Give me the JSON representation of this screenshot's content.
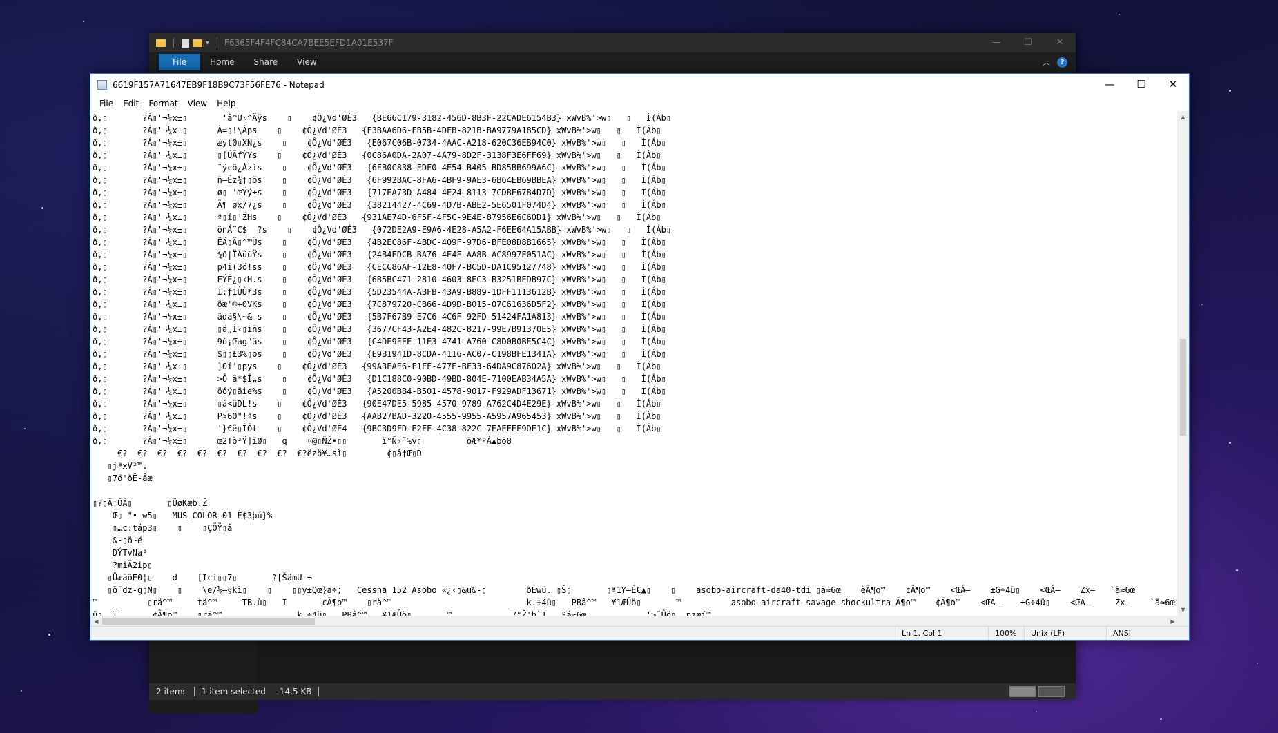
{
  "explorer": {
    "title": "F6365F4F4FC84CA7BEE5EFD1A01E537F",
    "ribbon_tabs": [
      "File",
      "Home",
      "Share",
      "View"
    ],
    "status": {
      "items": "2 items",
      "selected": "1 item selected",
      "size": "14.5 KB"
    }
  },
  "notepad": {
    "title": "6619F157A71647EB9F18B9C73F56FE76 - Notepad",
    "menu": [
      "File",
      "Edit",
      "Format",
      "View",
      "Help"
    ],
    "content_lines": [
      "ð,▯       ?Á▯'¬¼x±▯       'â^U‹^Äÿs    ▯    ¢Ô¿Vd'ØÉ3   {BE66C179-3182-456D-8B3F-22CADE6154B3} xWvB%'>w▯   ▯   Ì(Áb▯",
      "ð,▯       ?Á▯'¬¼x±▯      À=▯!\\Âps    ▯    ¢Ô¿Vd'ØÉ3   {F3BAA6D6-FB5B-4DFB-821B-BA9779A185CD} xWvB%'>w▯   ▯   Ì(Áb▯",
      "ð,▯       ?Á▯'¬¼x±▯      æyt0▯XN¿s    ▯    ¢Ô¿Vd'ØÉ3   {E067C06B-0734-4AAC-A218-620C36EB94C0} xWvB%'>w▯   ▯   Ì(Áb▯",
      "ð,▯       ?Á▯'¬¼x±▯      ▯[ÜÃfÝYs    ▯    ¢Ô¿Vd'ØÉ3   {0C86A0DA-2A07-4A79-8D2F-3138F3E6FF69} xWvB%'>w▯   ▯   Ì(Áb▯",
      "ð,▯       ?Á▯'¬¼x±▯      ¨ÿcö¿Àzìs    ▯    ¢Ô¿Vd'ØÉ3   {6FB0C838-EDF0-4E54-B405-BD85BB699A6C} xWvB%'>w▯   ▯   Ì(Áb▯",
      "ð,▯       ?Á▯'¬¼x±▯      ñ–Ëz¾†▯ös    ▯    ¢Ô¿Vd'ØÉ3   {6F992BAC-8FA6-4BF9-9AE3-6B64EB69BBEA} xWvB%'>w▯   ▯   Ì(Áb▯",
      "ð,▯       ?Á▯'¬¼x±▯      ø▯ 'œŸÿ±s    ▯    ¢Ô¿Vd'ØÉ3   {717EA73D-A484-4E24-8113-7CDBE67B4D7D} xWvB%'>w▯   ▯   Ì(Áb▯",
      "ð,▯       ?Á▯'¬¼x±▯      Ã¶ øx/7¿s    ▯    ¢Ô¿Vd'ØÉ3   {38214427-4C69-4D7B-ABE2-5E6501F074D4} xWvB%'>w▯   ▯   Ì(Áb▯",
      "ð,▯       ?Á▯'¬¼x±▯      ª▯í▯¹ŽHs    ▯    ¢Ô¿Vd'ØÉ3   {931AE74D-6F5F-4F5C-9E4E-87956E6C60D1} xWvB%'>w▯   ▯   Ì(Áb▯",
      "ð,▯       ?Á▯'¬¼x±▯      õnÄ¨C$  ?s    ▯    ¢Ô¿Vd'ØÉ3   {072DE2A9-E9A6-4E28-A5A2-F6EE64A15ABB} xWvB%'>w▯   ▯   Ì(Áb▯",
      "ð,▯       ?Á▯'¬¼x±▯      ËÄ▯Ä▯^™Ûs    ▯    ¢Ô¿Vd'ØÉ3   {4B2EC86F-4BDC-409F-97D6-BFE08D8B1665} xWvB%'>w▯   ▯   Ì(Áb▯",
      "ð,▯       ?Á▯'¬¼x±▯      ¾ð|ÏÁûùŸs    ▯    ¢Ô¿Vd'ØÉ3   {24B4EDCB-BA76-4E4F-AA8B-AC8997E051AC} xWvB%'>w▯   ▯   Ì(Áb▯",
      "ð,▯       ?Á▯'¬¼x±▯      p4i(3ö!ss    ▯    ¢Ô¿Vd'ØÉ3   {CECC86AF-12E8-40F7-BC5D-DA1C95127748} xWvB%'>w▯   ▯   Ì(Áb▯",
      "ð,▯       ?Á▯'¬¼x±▯      EŸÉ¿▯‹H.s    ▯    ¢Ô¿Vd'ØÉ3   {6B5BC471-2810-4603-8EC3-B3251BEDB97C} xWvB%'>w▯   ▯   Ì(Áb▯",
      "ð,▯       ?Á▯'¬¼x±▯      Í:ƒ1ÙÙ*3s    ▯    ¢Ô¿Vd'ØÉ3   {5D23544A-ABFB-43A9-B889-1DFF1113612B} xWvB%'>w▯   ▯   Ì(Áb▯",
      "ð,▯       ?Á▯'¬¼x±▯      õæ'®+0VKs    ▯    ¢Ô¿Vd'ØÉ3   {7C879720-CB66-4D9D-B015-07C61636D5F2} xWvB%'>w▯   ▯   Ì(Áb▯",
      "ð,▯       ?Á▯'¬¼x±▯      ädä§\\~& s    ▯    ¢Ô¿Vd'ØÉ3   {5B7F67B9-E7C6-4C6F-92FD-51424FA1A813} xWvB%'>w▯   ▯   Ì(Áb▯",
      "ð,▯       ?Á▯'¬¼x±▯      ▯ä„Í‹▯ìñs    ▯    ¢Ô¿Vd'ØÉ3   {3677CF43-A2E4-482C-8217-99E7B91370E5} xWvB%'>w▯   ▯   Ì(Áb▯",
      "ð,▯       ?Á▯'¬¼x±▯      9ò¡Œag\"äs    ▯    ¢Ô¿Vd'ØÉ3   {C4DE9EEE-11E3-4741-A760-C8D0B0BE5C4C} xWvB%'>w▯   ▯   Ì(Áb▯",
      "ð,▯       ?Á▯'¬¼x±▯      $▯▯£3%▯os    ▯    ¢Ô¿Vd'ØÉ3   {E9B1941D-8CDA-4116-AC07-C198BFE1341A} xWvB%'>w▯   ▯   Ì(Áb▯",
      "ð,▯       ?Á▯'¬¼x±▯      ]0í'▯pys    ▯    ¢Ô¿Vd'ØÉ3   {99A3EAE6-F1FF-477E-BF33-64DA9C87602A} xWvB%'>w▯   ▯   Ì(Áb▯",
      "ð,▯       ?Á▯'¬¼x±▯      >Ô â*$Í„s    ▯    ¢Ô¿Vd'ØÉ3   {D1C188C0-90BD-49BD-804E-7100EAB34A5A} xWvB%'>w▯   ▯   Ì(Áb▯",
      "ð,▯       ?Á▯'¬¼x±▯      öóÿ▯äie%s    ▯    ¢Ô¿Vd'ØÉ3   {A5200BB4-B501-4578-9017-F929ADF13671} xWvB%'>w▯   ▯   Ì(Áb▯",
      "ð,▯       ?Á▯'¬¼x±▯      ▯á<üDL!s    ▯    ¢Ô¿Vd'ØÉ3   {90E47DE5-5985-4570-9789-A762C4D4E29E} xWvB%'>w▯   ▯   Ì(Áb▯",
      "ð,▯       ?Á▯'¬¼x±▯      P¤60\"!ªs    ▯    ¢Ô¿Vd'ØÉ3   {AAB27BAD-3220-4555-9955-A5957A965453} xWvB%'>w▯   ▯   Ì(Áb▯",
      "ð,▯       ?Á▯'¬¼x±▯      '}€ë▯ÎÕt    ▯    ¢Ô¿Vd'ØÉ4   {9BC3D9FD-E2FF-4C38-822C-7EAEFEE9DE1C} xWvB%'>w▯   ▯   Ì(Áb▯",
      "ð,▯       ?Á▯'¬¼x±▯      œ2Tò²Ÿ]ïØ▯   q    ¤@▯ÑŽ•▯▯       ï°Ñ›˜%v▯         õÆ*ºÁ▲bö8",
      "     €?  €?  €?  €?  €?  €?  €?  €?  €?  €?ëzö¥…sì▯        ¢▯â†Œ▯D",
      "   ▯jªxV²™.",
      "   ▯7ö'ðË-åæ",
      "",
      "▯?▯Â¡ÕÃ▯       ▯ÜøKæb.Ž",
      "    Œ▯ \"• w5▯   MUS_COLOR_01 È$3þú}%",
      "    ▯…c:táp3▯    ▯    ▯ÇÖŸ▯â",
      "    &-▯ö~ë",
      "    DÝTvNa³",
      "    ?miÃ2ip▯",
      "   ▯ÜæäõE0¦▯    d    [Ici▯▯7▯       ?[ŠämU–¬",
      "   ▯ö˜dz-g▯N▯    ▯    \\e/½–§kì▯    ▯    ▯▯y±Qœ}a÷;   Cessna 152 Asobo «¿‹▯&u&-▯        ðÈwü. ▯Š▯       ▯ª1Y–É€▲▯    ▯    asobo-aircraft-da40-tdi ▯ã≈6œ    èÃ¶o™    ¢Ã¶o™    <ŒÁ–    ±G÷4ü▯    <ŒÁ–    Zx–   `ã≈6œ",
      "™          ▯rä^™     tä^™     TB.ù▯   I       ¢Ã¶o™    ▯rä^™                           k.÷4ü▯   PBâ^™   ¥1ÆÛö▯       ™          asobo-aircraft-savage-shockultra Ã¶o™    ¢Ã¶o™    <ŒÁ–    ±G÷4ü▯    <ŒÁ–     Zx–    `ã≈6œ",
      "ü▯  I       ¢Ã¶o™    ▯rä^™               k.÷4ü▯   PBâ^™   ¥1ÆÛö▯       ™            7°Ž'h`1   ºá≈6œ            '>˜Ûö▯  pzæí™"
    ],
    "status": {
      "position": "Ln 1, Col 1",
      "zoom": "100%",
      "line_ending": "Unix (LF)",
      "encoding": "ANSI"
    }
  }
}
